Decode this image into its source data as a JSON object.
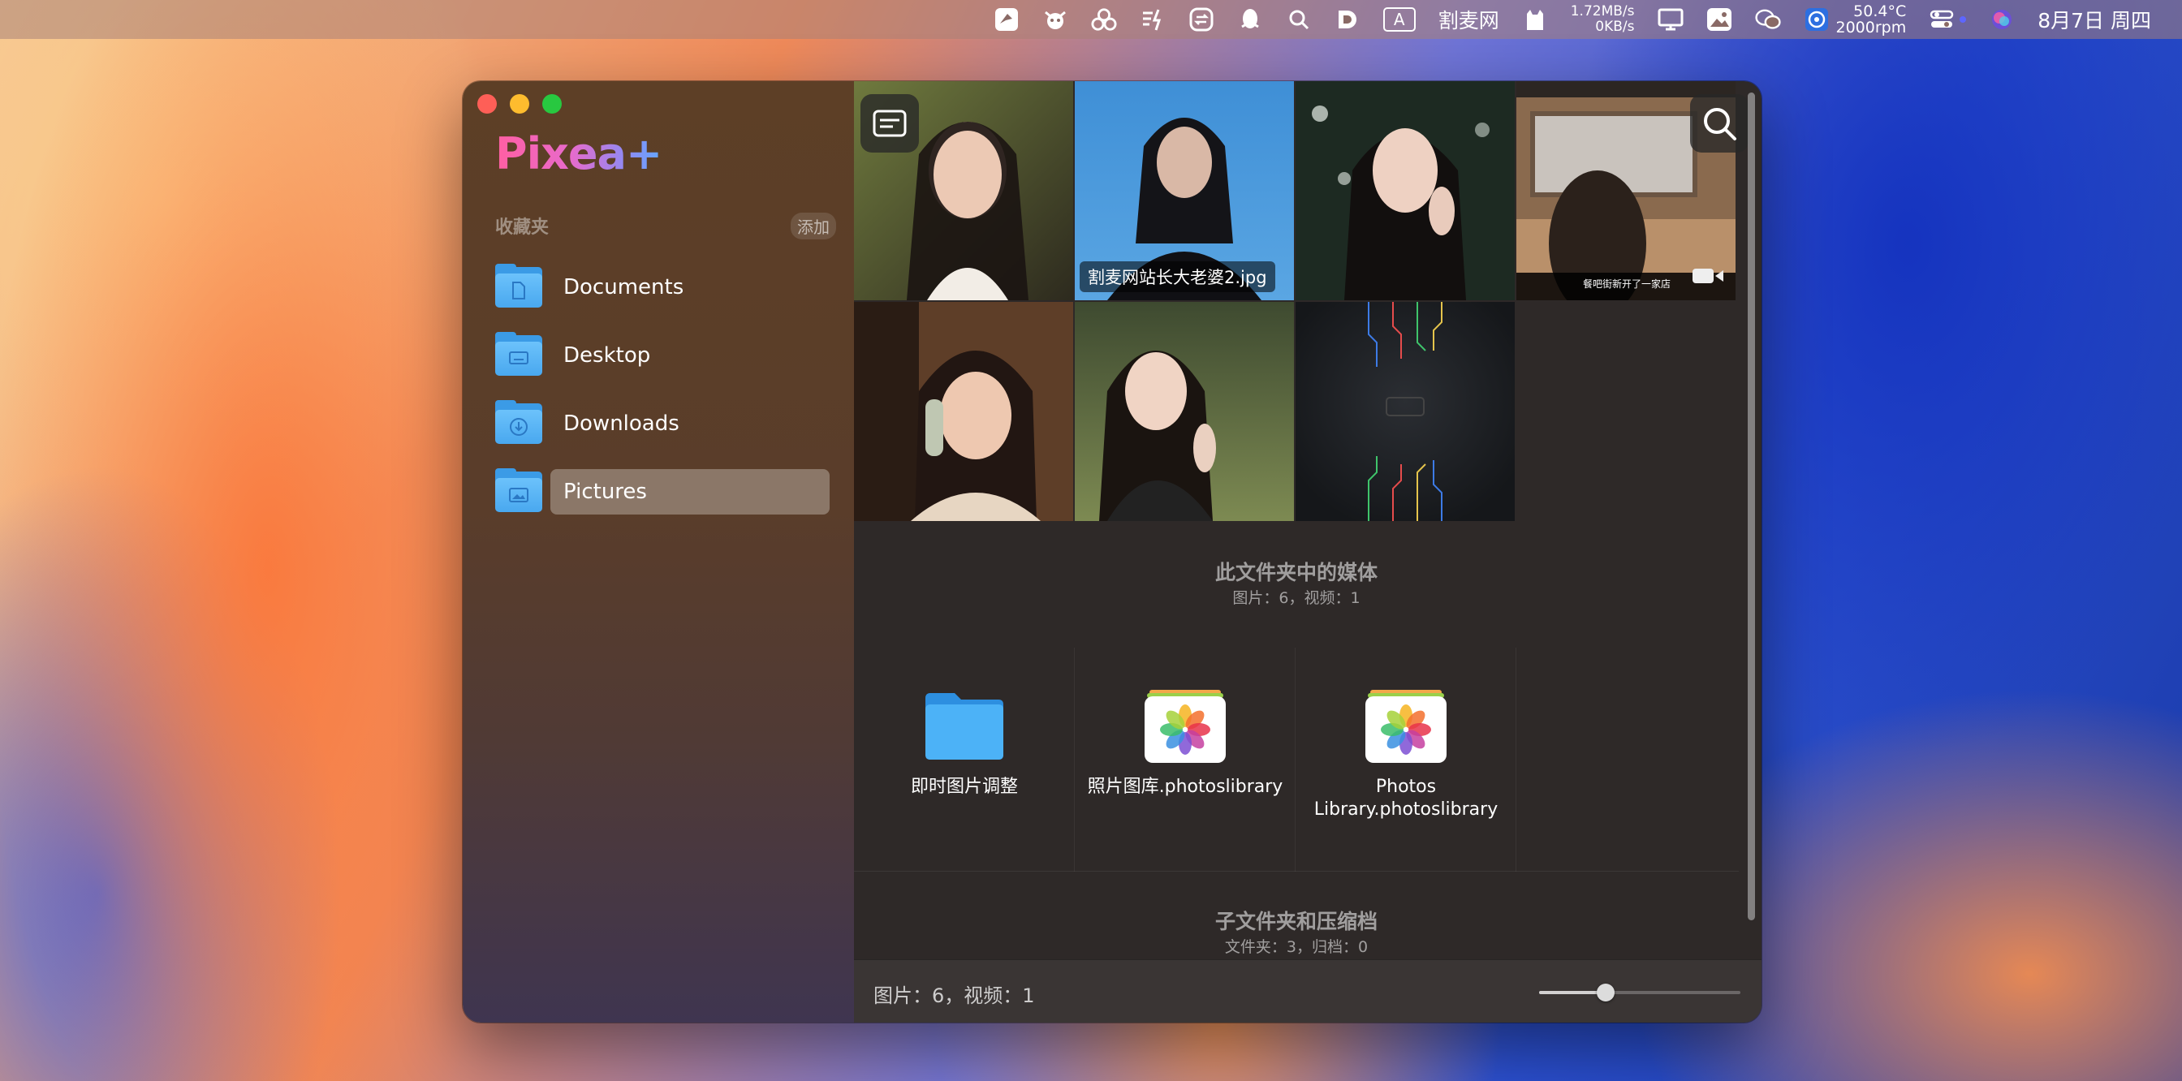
{
  "menubar": {
    "site_label": "割麦网",
    "net_up": "1.72MB/s",
    "net_down": "0KB/s",
    "temp": "50.4°C",
    "fan": "2000rpm",
    "datetime": "8月7日 周四",
    "input_method": "A"
  },
  "app": {
    "name": "Pixea+"
  },
  "sidebar": {
    "favorites_title": "收藏夹",
    "add_label": "添加",
    "items": [
      {
        "label": "Documents",
        "icon": "document-icon"
      },
      {
        "label": "Desktop",
        "icon": "desktop-icon"
      },
      {
        "label": "Downloads",
        "icon": "download-icon"
      },
      {
        "label": "Pictures",
        "icon": "picture-icon",
        "selected": true
      }
    ]
  },
  "grid": {
    "items": [
      {
        "type": "image"
      },
      {
        "type": "image",
        "caption": "割麦网站长大老婆2.jpg"
      },
      {
        "type": "image"
      },
      {
        "type": "video",
        "subtitle": "餐吧街新开了一家店"
      },
      {
        "type": "image"
      },
      {
        "type": "image"
      },
      {
        "type": "image"
      }
    ]
  },
  "media_section": {
    "title": "此文件夹中的媒体",
    "summary": "图片：6，视频：1"
  },
  "tiles": [
    {
      "name": "即时图片调整",
      "icon": "folder-icon"
    },
    {
      "name": "照片图库.photoslibrary",
      "icon": "photos-library-icon"
    },
    {
      "name": "Photos Library.photoslibrary",
      "icon": "photos-library-icon"
    }
  ],
  "subfolder_section": {
    "title": "子文件夹和压缩档",
    "summary": "文件夹：3，归档：0"
  },
  "statusbar": {
    "text": "图片：6，视频：1",
    "zoom_level": 0.33
  },
  "colors": {
    "accent_pink": "#ff5fa2",
    "accent_blue": "#63a7ff",
    "folder_blue": "#49a8ef"
  }
}
